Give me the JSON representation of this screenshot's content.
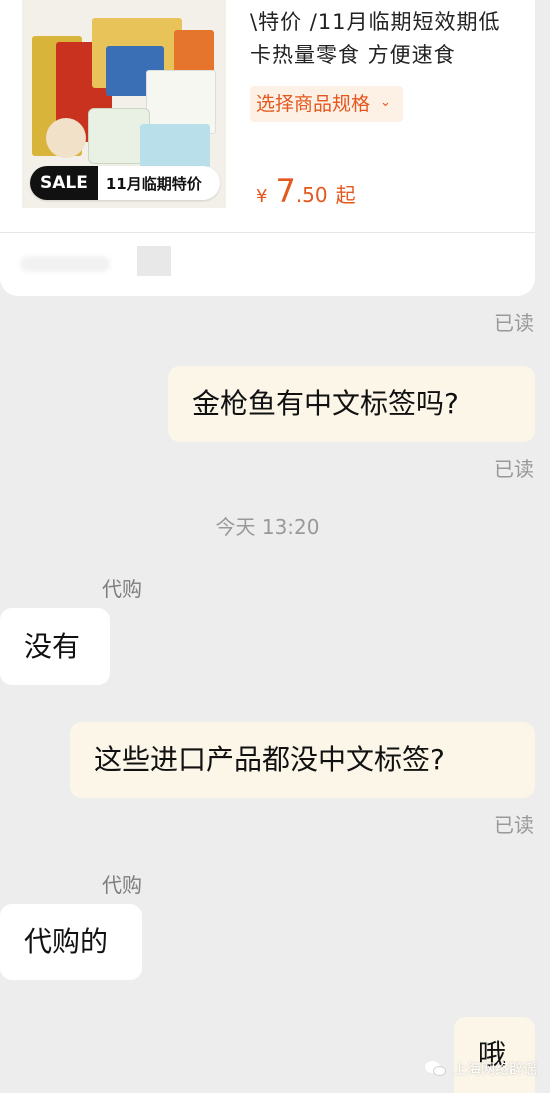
{
  "product": {
    "title": "\\特价 /11月临期短效期低卡热量零食 方便速食",
    "spec_label": "选择商品规格",
    "price_currency": "¥",
    "price_integer": "7",
    "price_decimal": ".50",
    "price_suffix": "起",
    "sale_tag": "SALE",
    "sale_text": "11月临期特价",
    "image_label": "product-thumbnail"
  },
  "messages": {
    "read_1": "已读",
    "out_1": "金枪鱼有中文标签吗?",
    "read_2": "已读",
    "timestamp": "今天 13:20",
    "sender_1": "代购",
    "in_1": "没有",
    "out_2": "这些进口产品都没中文标签?",
    "read_3": "已读",
    "sender_2": "代购",
    "in_2": "代购的",
    "out_3": "哦"
  },
  "watermark": {
    "text": "上海网络辟谣",
    "icon": "wechat-icon"
  },
  "colors": {
    "accent": "#e4571e",
    "outgoing_bubble": "#fcf6e9",
    "incoming_bubble": "#ffffff",
    "background": "#ededed"
  }
}
